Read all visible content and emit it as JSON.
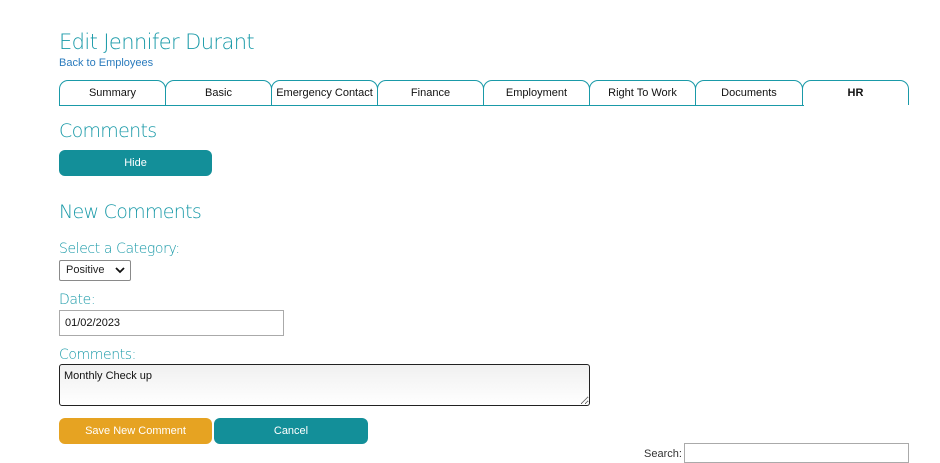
{
  "page": {
    "title": "Edit Jennifer Durant",
    "back_link": "Back to Employees"
  },
  "tabs": [
    {
      "label": "Summary",
      "active": false
    },
    {
      "label": "Basic",
      "active": false
    },
    {
      "label": "Emergency Contact",
      "active": false
    },
    {
      "label": "Finance",
      "active": false
    },
    {
      "label": "Employment",
      "active": false
    },
    {
      "label": "Right To Work",
      "active": false
    },
    {
      "label": "Documents",
      "active": false
    },
    {
      "label": "HR",
      "active": true
    }
  ],
  "comments_section": {
    "heading": "Comments",
    "hide_button": "Hide"
  },
  "new_comments": {
    "heading": "New Comments",
    "category_label": "Select a Category:",
    "category_value": "Positive",
    "date_label": "Date:",
    "date_value": "01/02/2023",
    "comments_label": "Comments:",
    "comments_value": "Monthly Check up",
    "save_button": "Save New Comment",
    "cancel_button": "Cancel"
  },
  "search": {
    "label": "Search:",
    "value": ""
  },
  "colors": {
    "accent": "#1a9aa8",
    "button_teal": "#138f99",
    "button_orange": "#e6a322",
    "link": "#2a7bbd"
  }
}
